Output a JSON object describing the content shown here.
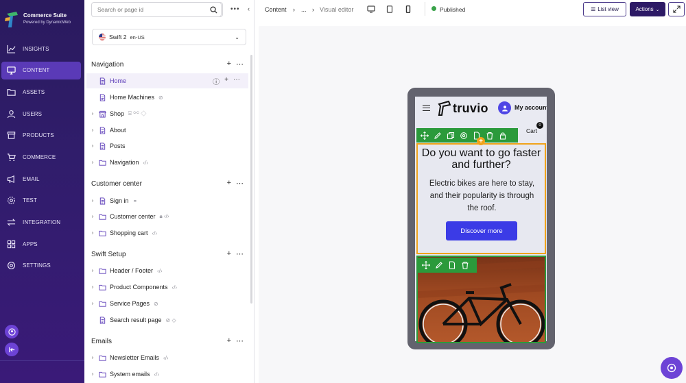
{
  "brand": {
    "title": "Commerce Suite",
    "subtitle": "Powered by DynamicWeb"
  },
  "rail": {
    "items": [
      {
        "label": "INSIGHTS",
        "icon": "chart-line-icon",
        "active": false
      },
      {
        "label": "CONTENT",
        "icon": "monitor-icon",
        "active": true
      },
      {
        "label": "ASSETS",
        "icon": "folder-icon",
        "active": false
      },
      {
        "label": "USERS",
        "icon": "user-icon",
        "active": false
      },
      {
        "label": "PRODUCTS",
        "icon": "box-icon",
        "active": false
      },
      {
        "label": "COMMERCE",
        "icon": "cart-icon",
        "active": false
      },
      {
        "label": "EMAIL",
        "icon": "megaphone-icon",
        "active": false
      },
      {
        "label": "TEST",
        "icon": "gear-icon",
        "active": false
      },
      {
        "label": "INTEGRATION",
        "icon": "arrows-icon",
        "active": false
      },
      {
        "label": "APPS",
        "icon": "grid-icon",
        "active": false
      },
      {
        "label": "SETTINGS",
        "icon": "settings-icon",
        "active": false
      }
    ]
  },
  "tree": {
    "search_placeholder": "Search or page id",
    "site": {
      "name": "Swift 2",
      "lang": "en-US"
    },
    "sections": {
      "navigation": "Navigation",
      "customer_center": "Customer center",
      "swift_setup": "Swift Setup",
      "emails": "Emails"
    },
    "rows": {
      "home": "Home",
      "home_machines": "Home Machines",
      "shop": "Shop",
      "about": "About",
      "posts": "Posts",
      "navigation": "Navigation",
      "sign_in": "Sign in",
      "customer_center": "Customer center",
      "shopping_cart": "Shopping cart",
      "header_footer": "Header / Footer",
      "product_components": "Product Components",
      "service_pages": "Service Pages",
      "search_result": "Search result page",
      "newsletter": "Newsletter Emails",
      "system_emails": "System emails"
    }
  },
  "topbar": {
    "crumb1": "Content",
    "crumb_sep1": "›",
    "crumb2": "...",
    "crumb_sep2": "›",
    "crumb3": "Visual editor",
    "status": "Published",
    "list_view": "List view",
    "actions": "Actions"
  },
  "preview": {
    "logo": "truvio",
    "account": "My account",
    "cart": "Cart",
    "cart_count": "0",
    "hero_title": "Do you want to go faster and further?",
    "hero_text": "Electric bikes are here to stay, and their popularity is through the roof.",
    "hero_button": "Discover more"
  },
  "colors": {
    "rail_bg": "#301d6b",
    "rail_active": "#5a3ab7",
    "accent": "#6d43d6",
    "selection_orange": "#f0a31a",
    "toolbar_green": "#2b9a3b",
    "hero_button": "#3b3be6"
  }
}
